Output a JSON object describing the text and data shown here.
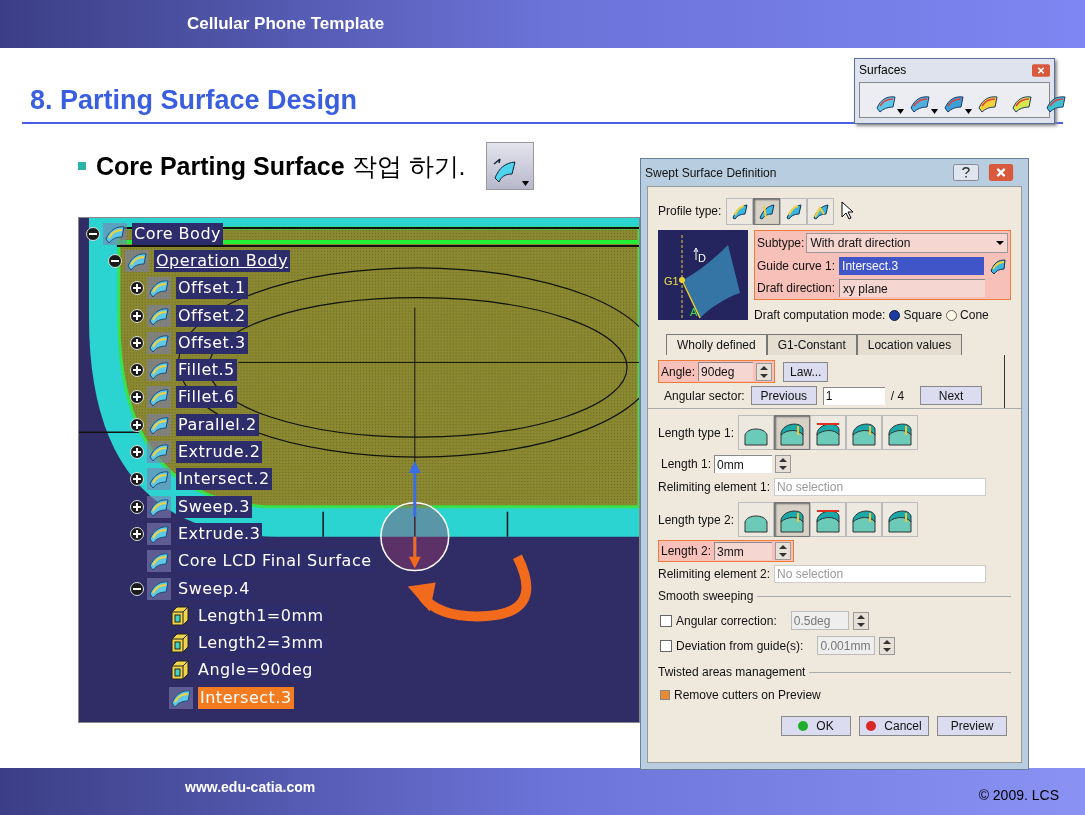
{
  "header": {
    "title": "Cellular Phone Template"
  },
  "toolbar": {
    "title": "Surfaces",
    "tools": [
      {
        "dropdown": true
      },
      {
        "dropdown": true
      },
      {
        "dropdown": true
      },
      {
        "dropdown": false
      },
      {
        "dropdown": false
      },
      {
        "dropdown": false
      }
    ]
  },
  "heading": "8. Parting Surface Design",
  "bullet": "**Core Parting Surface** 작업 하기.",
  "tree": [
    {
      "label": "Core Body",
      "expanded": true,
      "selected": false,
      "current": false,
      "children": [
        {
          "label": "Operation Body",
          "expanded": true,
          "selected": false,
          "current": true,
          "children": [
            {
              "label": "Offset.1",
              "expanded": false,
              "selected": false,
              "current": false
            },
            {
              "label": "Offset.2",
              "expanded": false,
              "selected": false,
              "current": false
            },
            {
              "label": "Offset.3",
              "expanded": false,
              "selected": false,
              "current": false
            },
            {
              "label": "Fillet.5",
              "expanded": false,
              "selected": false,
              "current": false
            },
            {
              "label": "Fillet.6",
              "expanded": false,
              "selected": false,
              "current": false
            },
            {
              "label": "Parallel.2",
              "expanded": false,
              "selected": false,
              "current": false
            },
            {
              "label": "Extrude.2",
              "expanded": false,
              "selected": false,
              "current": false
            },
            {
              "label": "Intersect.2",
              "expanded": false,
              "selected": false,
              "current": false
            },
            {
              "label": "Sweep.3",
              "expanded": false,
              "selected": false,
              "current": false
            },
            {
              "label": "Extrude.3",
              "expanded": false,
              "selected": false,
              "current": false
            },
            {
              "label": "Core LCD Final Surface",
              "selected": false,
              "current": false
            },
            {
              "label": "Sweep.4",
              "expanded": true,
              "selected": false,
              "current": false,
              "children": [
                {
                  "label": "Length1=0mm",
                  "kind": "parameter",
                  "selected": false,
                  "current": false
                },
                {
                  "label": "Length2=3mm",
                  "kind": "parameter",
                  "selected": false,
                  "current": false
                },
                {
                  "label": "Angle=90deg",
                  "kind": "parameter",
                  "selected": false,
                  "current": false
                },
                {
                  "label": "Intersect.3",
                  "kind": "feature",
                  "selected": true,
                  "current": false
                }
              ]
            }
          ]
        }
      ]
    }
  ],
  "dialog": {
    "title": "Swept Surface Definition",
    "profile_type": {
      "label": "Profile type:",
      "options": [
        {
          "selected": false
        },
        {
          "selected": true
        },
        {
          "selected": false
        },
        {
          "selected": false
        }
      ]
    },
    "diagram_labels": [
      "D",
      "G1",
      "A"
    ],
    "direction_group": {
      "highlighted": true,
      "subtype": {
        "label": "Subtype:",
        "value": "With draft direction"
      },
      "guide_curve": {
        "label": "Guide curve 1:",
        "value": "Intersect.3"
      },
      "draft_direction": {
        "label": "Draft direction:",
        "value": "xy plane"
      }
    },
    "draft_mode": {
      "label": "Draft computation mode:",
      "options": [
        {
          "label": "Square",
          "selected": true
        },
        {
          "label": "Cone",
          "selected": false
        }
      ]
    },
    "tabs": [
      {
        "label": "Wholly defined",
        "selected": true
      },
      {
        "label": "G1-Constant",
        "selected": false
      },
      {
        "label": "Location values",
        "selected": false
      }
    ],
    "angle": {
      "label": "Angle:",
      "value": "90deg",
      "highlighted": true,
      "law_button": "Law..."
    },
    "angular_sector": {
      "label": "Angular sector:",
      "previous": "Previous",
      "value": "1",
      "total": "/ 4",
      "next": "Next"
    },
    "length_type_1": {
      "label": "Length type 1:",
      "options": [
        {
          "selected": false
        },
        {
          "selected": true
        },
        {
          "selected": false
        },
        {
          "selected": false
        },
        {
          "selected": false
        }
      ]
    },
    "length_1": {
      "label": "Length 1:",
      "value": "0mm",
      "highlighted": false
    },
    "relimiting_1": {
      "label": "Relimiting element 1:",
      "placeholder": "No selection"
    },
    "length_type_2": {
      "label": "Length type 2:",
      "options": [
        {
          "selected": false
        },
        {
          "selected": true
        },
        {
          "selected": false
        },
        {
          "selected": false
        },
        {
          "selected": false
        }
      ]
    },
    "length_2": {
      "label": "Length 2:",
      "value": "3mm",
      "highlighted": true
    },
    "relimiting_2": {
      "label": "Relimiting element 2:",
      "placeholder": "No selection"
    },
    "smooth_sweeping": {
      "title": "Smooth sweeping",
      "options": [
        {
          "label": "Angular correction:",
          "checked": false,
          "value": "0.5deg"
        },
        {
          "label": "Deviation from guide(s):",
          "checked": false,
          "value": "0.001mm"
        }
      ]
    },
    "twisted": {
      "title": "Twisted areas management",
      "option": {
        "label": "Remove cutters on Preview",
        "checked": true
      }
    },
    "buttons": [
      {
        "label": "OK",
        "kind": "ok"
      },
      {
        "label": "Cancel",
        "kind": "cancel"
      },
      {
        "label": "Preview",
        "kind": "plain"
      }
    ]
  },
  "footer": {
    "url": "www.edu-catia.com",
    "copyright": "© 2009. LCS"
  }
}
